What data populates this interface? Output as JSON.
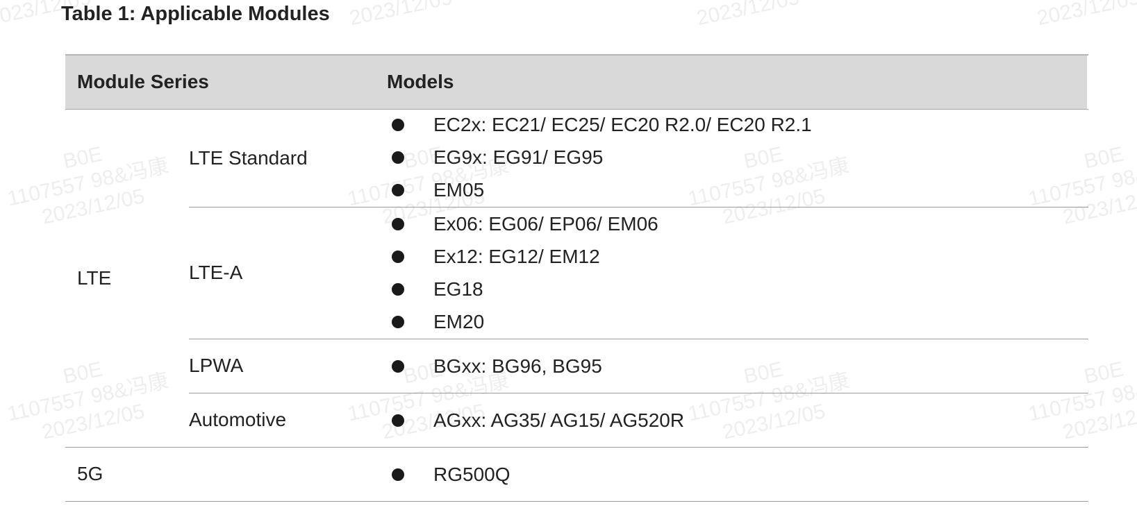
{
  "caption": "Table 1: Applicable Modules",
  "header": {
    "series": "Module Series",
    "models": "Models"
  },
  "rows": [
    {
      "series": "LTE",
      "sub": "LTE Standard",
      "models": [
        "EC2x: EC21/ EC25/ EC20 R2.0/ EC20 R2.1",
        "EG9x: EG91/ EG95",
        "EM05"
      ]
    },
    {
      "sub": "LTE-A",
      "models": [
        "Ex06: EG06/ EP06/ EM06",
        "Ex12: EG12/ EM12",
        "EG18",
        "EM20"
      ]
    },
    {
      "sub": "LPWA",
      "models": [
        "BGxx: BG96, BG95"
      ]
    },
    {
      "sub": "Automotive",
      "models": [
        "AGxx: AG35/ AG15/ AG520R"
      ]
    },
    {
      "series": "5G",
      "sub": "",
      "models": [
        "RG500Q"
      ]
    }
  ],
  "watermark": {
    "lines": [
      "B0E",
      "1107557 98&冯康",
      "2023/12/05"
    ],
    "color": "#969696"
  }
}
